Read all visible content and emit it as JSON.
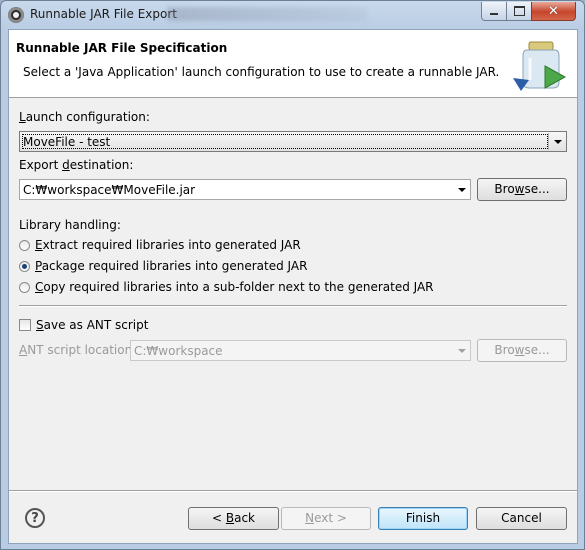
{
  "window": {
    "title": "Runnable JAR File Export",
    "icon": "eclipse-icon"
  },
  "banner": {
    "title": "Runnable JAR File Specification",
    "description": "Select a 'Java Application' launch configuration to use to create a runnable JAR.",
    "icon": "jar-export-icon"
  },
  "launch": {
    "label_pre": "",
    "label_mn": "L",
    "label_post": "aunch configuration:",
    "value": "MoveFile - test"
  },
  "export": {
    "label_pre": "Export ",
    "label_mn": "d",
    "label_post": "estination:",
    "value": "C:₩workspace₩MoveFile.jar",
    "browse_pre": "Bro",
    "browse_mn": "w",
    "browse_post": "se..."
  },
  "library": {
    "label": "Library handling:",
    "options": [
      {
        "mn": "E",
        "rest": "xtract required libraries into generated JAR",
        "selected": false
      },
      {
        "mn": "P",
        "rest": "ackage required libraries into generated JAR",
        "selected": true
      },
      {
        "mn": "C",
        "rest": "opy required libraries into a sub-folder next to the generated JAR",
        "selected": false
      }
    ]
  },
  "ant": {
    "checkbox_mn": "S",
    "checkbox_post": "ave as ANT script",
    "checked": false,
    "location_mn": "A",
    "location_post": "NT script location:",
    "location_value": "C:₩workspace",
    "browse_pre": "Bro",
    "browse_mn": "w",
    "browse_post": "se..."
  },
  "footer": {
    "help_glyph": "?",
    "back_pre": "< ",
    "back_mn": "B",
    "back_post": "ack",
    "next_mn": "N",
    "next_post": "ext >",
    "finish": "Finish",
    "cancel": "Cancel"
  }
}
